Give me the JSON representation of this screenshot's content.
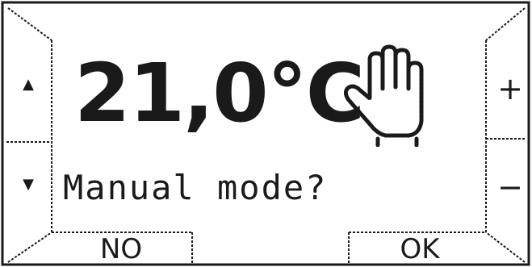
{
  "display": {
    "temperature": "21,0°C",
    "mode_icon": "hand-icon",
    "message": "Manual mode?"
  },
  "side_buttons": {
    "up": "▲",
    "down": "▼",
    "plus": "+",
    "minus": "−"
  },
  "softkeys": {
    "no_label": "NO",
    "ok_label": "OK"
  },
  "colors": {
    "ink": "#1a1a1a",
    "background": "#ffffff"
  }
}
